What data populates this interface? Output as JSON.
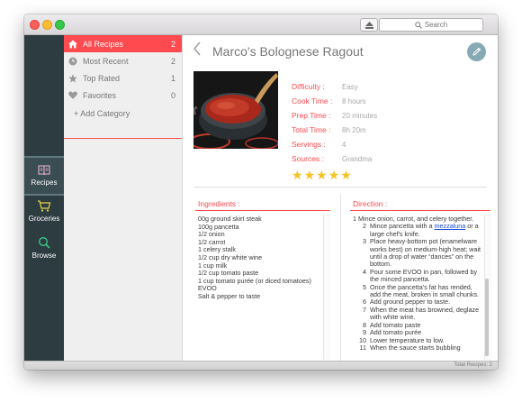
{
  "toolbar": {
    "search_placeholder": "Search"
  },
  "leftbar": {
    "items": [
      {
        "label": "Recipes",
        "icon": "book-icon"
      },
      {
        "label": "Groceries",
        "icon": "cart-icon"
      },
      {
        "label": "Browse",
        "icon": "search-icon"
      }
    ]
  },
  "categories": {
    "items": [
      {
        "label": "All Recipes",
        "count": "2",
        "icon": "home-icon"
      },
      {
        "label": "Most Recent",
        "count": "2",
        "icon": "clock-icon"
      },
      {
        "label": "Top Rated",
        "count": "1",
        "icon": "star-icon"
      },
      {
        "label": "Favorites",
        "count": "0",
        "icon": "heart-icon"
      }
    ],
    "add_label": "+ Add Category"
  },
  "recipe": {
    "title": "Marco's Bolognese Ragout",
    "meta": [
      {
        "label": "Difficulty :",
        "value": "Easy"
      },
      {
        "label": "Cook Time :",
        "value": "8 hours"
      },
      {
        "label": "Prep Time :",
        "value": "20 minutes"
      },
      {
        "label": "Total Time :",
        "value": "8h 20m"
      },
      {
        "label": "Servings :",
        "value": "4"
      },
      {
        "label": "Sources :",
        "value": "Grandma"
      }
    ],
    "rating": 5,
    "ingredients_title": "Ingredients :",
    "ingredients": [
      "00g ground skirt steak",
      "100g pancetta",
      "1/2 onion",
      "1/2 carrot",
      "1 celery stalk",
      "1/2 cup dry white wine",
      "1 cup milk",
      "1/2 cup tomato paste",
      "1 cup tomato purée (or diced tomatoes)",
      "EVOO",
      "Salt & pepper to taste"
    ],
    "directions_title": "Direction :",
    "directions": {
      "first": "1 Mince onion, carrot, and celery together.",
      "d2_num": "2",
      "d2_a": "Mince pancetta with a ",
      "d2_link": "mezzaluna",
      "d2_b": " or a large chef's knife.",
      "rest": [
        {
          "num": "3",
          "text": "Place heavy-bottom pot (enamelware works best) on medium-high heat; wait until a drop of water “dances” on the bottom."
        },
        {
          "num": "4",
          "text": "Pour some EVOO in pan, followed by the minced pancetta."
        },
        {
          "num": "5",
          "text": "Once the pancetta’s fat has rended, add the meat, broken in small chunks."
        },
        {
          "num": "6",
          "text": "Add ground pepper to taste."
        },
        {
          "num": "7",
          "text": "When the meat has browned, deglaze with white wine."
        },
        {
          "num": "8",
          "text": "Add tomato paste"
        },
        {
          "num": "9",
          "text": "Add tomato purée"
        },
        {
          "num": "10",
          "text": "Lower temperature to low."
        },
        {
          "num": "11",
          "text": "When the sauce starts bubbling"
        }
      ]
    }
  },
  "status": {
    "text": "Total Recipes: 2"
  },
  "colors": {
    "accent": "#ff4a4f",
    "sidebar": "#2c3c40",
    "star": "#f6c322",
    "edit_button": "#86aab4"
  }
}
